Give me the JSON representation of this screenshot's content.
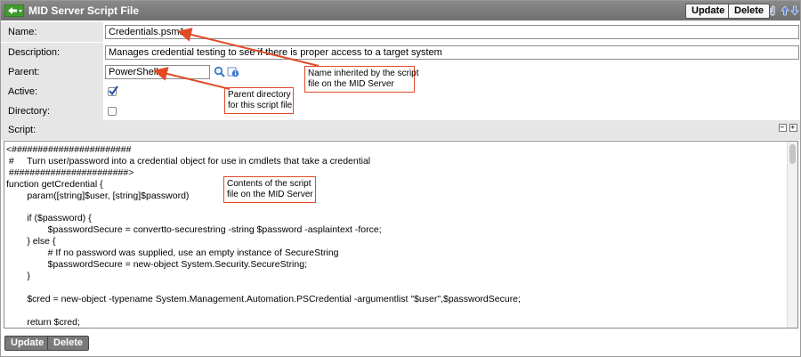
{
  "window": {
    "title": "MID Server Script File",
    "update_label": "Update",
    "delete_label": "Delete"
  },
  "fields": {
    "name": {
      "label": "Name:",
      "value": "Credentials.psm1"
    },
    "description": {
      "label": "Description:",
      "value": "Manages credential testing to see if there is proper access to a target system"
    },
    "parent": {
      "label": "Parent:",
      "value": "PowerShell"
    },
    "active": {
      "label": "Active:",
      "checked": true
    },
    "directory": {
      "label": "Directory:",
      "checked": false
    }
  },
  "script": {
    "label": "Script:",
    "code": "<#######################\n #     Turn user/password into a credential object for use in cmdlets that take a credential\n #######################>\nfunction getCredential {\n        param([string]$user, [string]$password)\n\n        if ($password) {\n                $passwordSecure = convertto-securestring -string $password -asplaintext -force;\n        } else {\n                # If no password was supplied, use an empty instance of SecureString\n                $passwordSecure = new-object System.Security.SecureString;\n        }\n\n        $cred = new-object -typename System.Management.Automation.PSCredential -argumentlist \"$user\",$passwordSecure;\n\n        return $cred;\n}"
  },
  "footer": {
    "update_label": "Update",
    "delete_label": "Delete"
  },
  "callouts": {
    "name": "Name inherited by the script\nfile on the MID Server",
    "parent": "Parent directory\nfor this script file",
    "script": "Contents of the script\nfile on the MID Server"
  },
  "icons": {
    "back": "back-arrow-icon",
    "search": "magnifier-icon",
    "reference": "reference-info-icon",
    "attachment": "paperclip-icon",
    "up": "up-arrow-icon",
    "down": "down-arrow-icon"
  },
  "colors": {
    "titlebar": "#7a7a7a",
    "callout_border": "#e04a25",
    "label_bg": "#e6e6e6"
  }
}
